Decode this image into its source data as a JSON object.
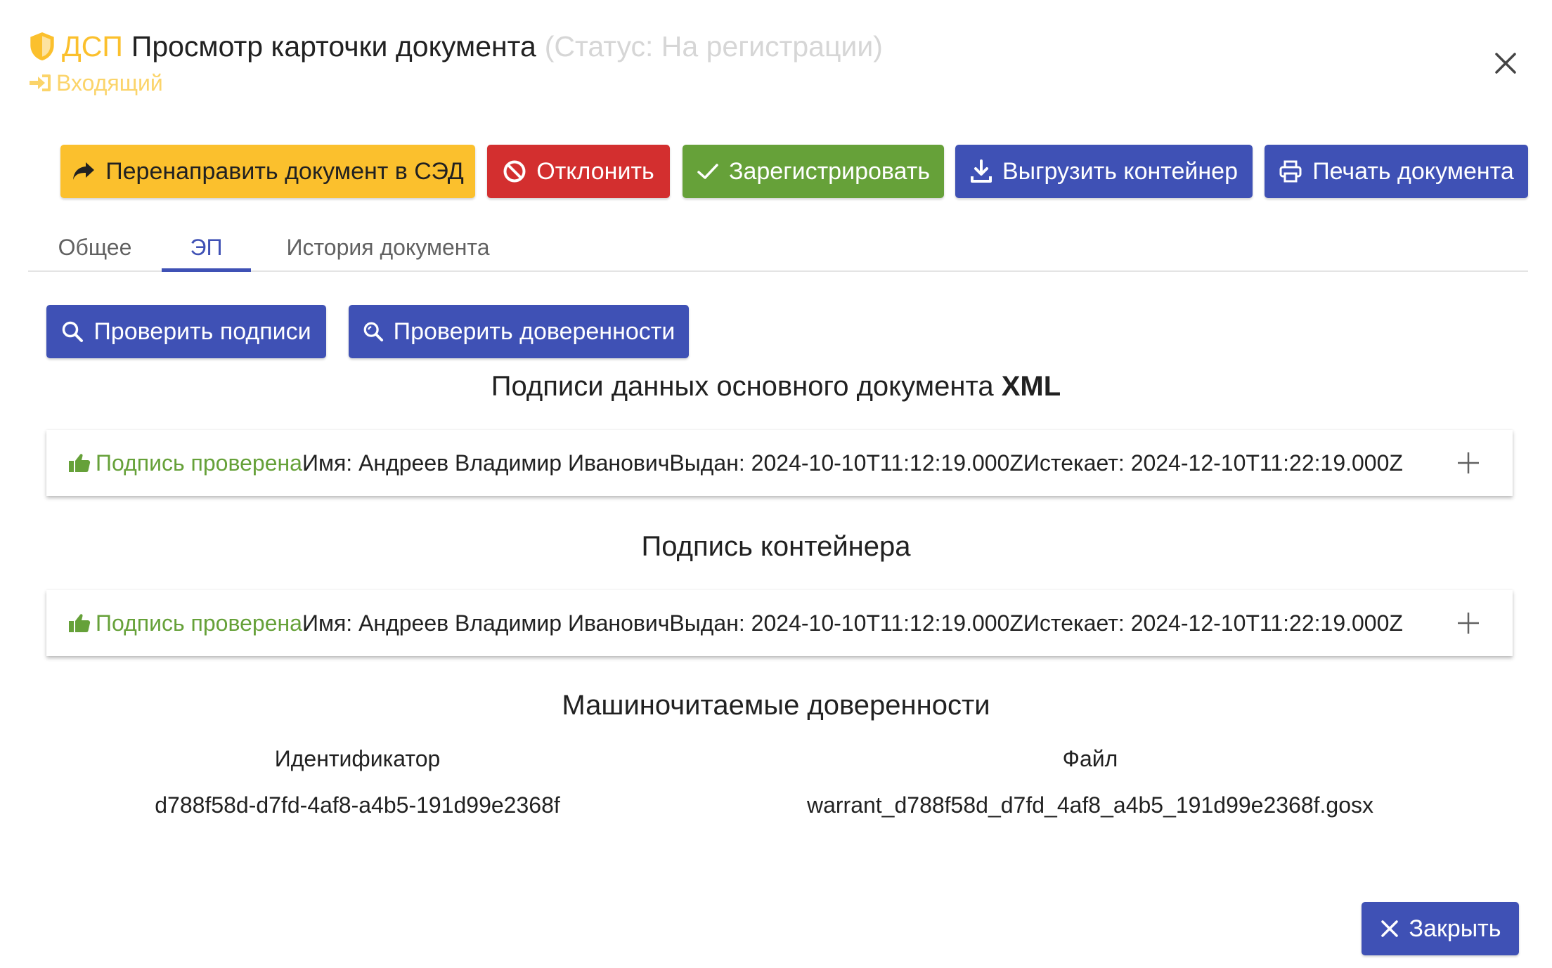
{
  "header": {
    "dsp_label": "ДСП",
    "title": "Просмотр карточки документа",
    "status": "(Статус: На регистрации)",
    "direction": "Входящий",
    "icons": {
      "classification": "shield-icon",
      "direction": "sign-in-icon",
      "close": "close-icon"
    }
  },
  "actions": {
    "redirect": "Перенаправить документ в СЭД",
    "reject": "Отклонить",
    "register": "Зарегистрировать",
    "export": "Выгрузить контейнер",
    "print": "Печать документа"
  },
  "tabs": [
    {
      "label": "Общее",
      "active": false
    },
    {
      "label": "ЭП",
      "active": true
    },
    {
      "label": "История документа",
      "active": false
    }
  ],
  "check_buttons": {
    "signatures": "Проверить подписи",
    "warrants": "Проверить доверенности"
  },
  "sections": {
    "main_doc_prefix": "Подписи данных основного документа",
    "main_doc_suffix": "XML",
    "container": "Подпись контейнера",
    "warrants": "Машиночитаемые доверенности"
  },
  "signatures": {
    "main": {
      "status": "Подпись проверена",
      "details": "Имя: Андреев Владимир ИвановичВыдан: 2024-10-10T11:12:19.000ZИстекает: 2024-12-10T11:22:19.000Z"
    },
    "container": {
      "status": "Подпись проверена",
      "details": "Имя: Андреев Владимир ИвановичВыдан: 2024-10-10T11:12:19.000ZИстекает: 2024-12-10T11:22:19.000Z"
    }
  },
  "warrants_table": {
    "columns": [
      "Идентификатор",
      "Файл"
    ],
    "rows": [
      [
        "d788f58d-d7fd-4af8-a4b5-191d99e2368f",
        "warrant_d788f58d_d7fd_4af8_a4b5_191d99e2368f.gosx"
      ]
    ]
  },
  "footer": {
    "close": "Закрыть"
  },
  "colors": {
    "primary": "#3f51b5",
    "warning": "#fbc02d",
    "danger": "#d32f2f",
    "success": "#66a139"
  }
}
